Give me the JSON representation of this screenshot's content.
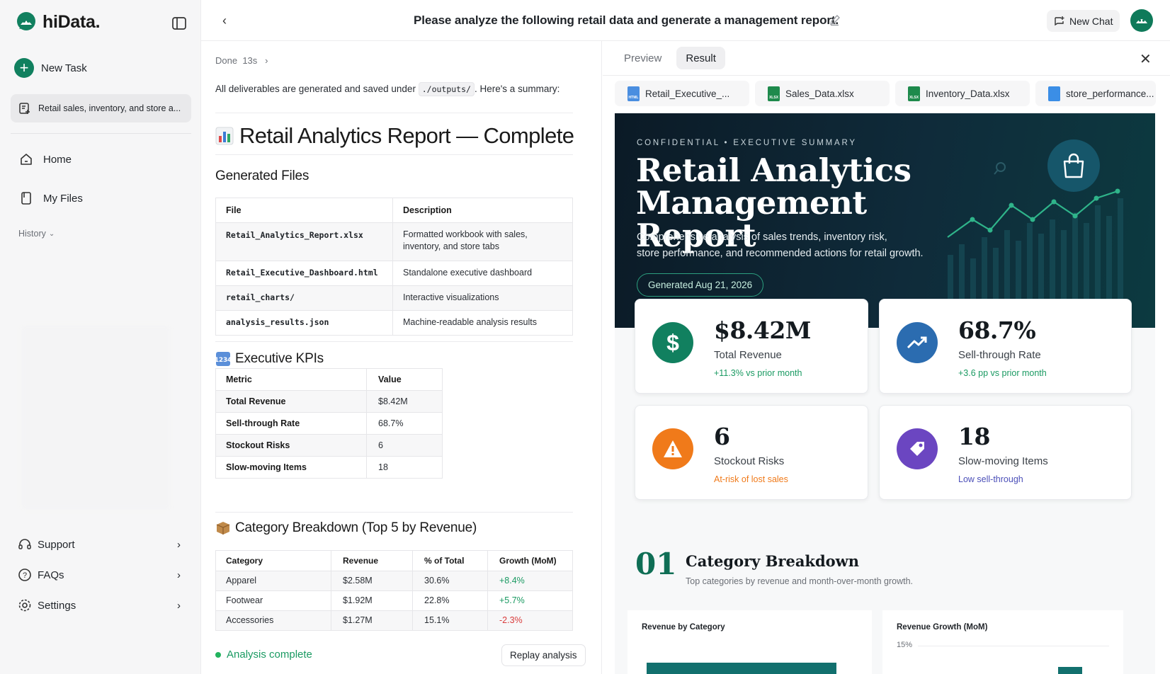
{
  "brand": {
    "name": "hiData."
  },
  "sidebar": {
    "new_task": "New Task",
    "active_task": "Retail sales, inventory, and store a...",
    "nav": [
      {
        "label": "Home"
      },
      {
        "label": "My Files"
      }
    ],
    "history": "History",
    "bottom": [
      {
        "label": "Support"
      },
      {
        "label": "FAQs"
      },
      {
        "label": "Settings"
      }
    ]
  },
  "topbar": {
    "title": "Please analyze the following retail data and generate a management report.",
    "new_chat": "New Chat"
  },
  "chat": {
    "done": "Done",
    "done_time": "13s",
    "summary_pre": "All deliverables are generated and saved under",
    "summary_code": "./outputs/",
    "summary_post": ". Here's a summary:",
    "report_title": "Retail Analytics Report — Complete",
    "files_heading": "Generated Files",
    "files_table": {
      "headers": [
        "File",
        "Description"
      ],
      "rows": [
        [
          "Retail_Analytics_Report.xlsx",
          "Formatted workbook with sales, inventory, and store tabs"
        ],
        [
          "Retail_Executive_Dashboard.html",
          "Standalone executive dashboard"
        ],
        [
          "retail_charts/",
          "Interactive visualizations"
        ],
        [
          "analysis_results.json",
          "Machine-readable analysis results"
        ]
      ]
    },
    "kpi_heading": "Executive KPIs",
    "kpi_table": {
      "headers": [
        "Metric",
        "Value"
      ],
      "rows": [
        [
          "Total Revenue",
          "$8.42M"
        ],
        [
          "Sell-through Rate",
          "68.7%"
        ],
        [
          "Stockout Risks",
          "6"
        ],
        [
          "Slow-moving Items",
          "18"
        ]
      ]
    },
    "category_heading": "Category Breakdown (Top 5 by Revenue)",
    "category_table": {
      "headers": [
        "Category",
        "Revenue",
        "% of Total",
        "Growth (MoM)"
      ],
      "rows": [
        [
          "Apparel",
          "$2.58M",
          "30.6%",
          "+8.4%"
        ],
        [
          "Footwear",
          "$1.92M",
          "22.8%",
          "+5.7%"
        ],
        [
          "Accessories",
          "$1.27M",
          "15.1%",
          "-2.3%"
        ]
      ]
    },
    "status": "Analysis complete",
    "replay": "Replay analysis"
  },
  "panel": {
    "tabs": [
      {
        "label": "Preview"
      },
      {
        "label": "Result"
      }
    ],
    "files": [
      {
        "name": "Retail_Executive_...",
        "type": "HTML",
        "color": "#4a8ee0"
      },
      {
        "name": "Sales_Data.xlsx",
        "type": "XLSX",
        "color": "#1e8a4c"
      },
      {
        "name": "Inventory_Data.xlsx",
        "type": "XLSX",
        "color": "#1e8a4c"
      },
      {
        "name": "store_performance...",
        "type": "",
        "color": "#3b8ee6"
      }
    ]
  },
  "report": {
    "eyebrow": "CONFIDENTIAL • EXECUTIVE SUMMARY",
    "title_line1": "Retail Analytics",
    "title_line2": "Management Report",
    "desc_line1": "Comprehensive analysis of sales trends, inventory risk,",
    "desc_line2": "store performance, and recommended actions for retail growth.",
    "generated": "Generated Aug 21, 2026",
    "kpis": [
      {
        "value": "$8.42M",
        "label": "Total Revenue",
        "sub": "+11.3% vs prior month",
        "color": "#11805f",
        "sub_color": "#1a9a62",
        "icon": "dollar-icon"
      },
      {
        "value": "68.7%",
        "label": "Sell-through Rate",
        "sub": "+3.6 pp vs prior month",
        "color": "#2b6cb0",
        "sub_color": "#1a9a62",
        "icon": "trend-up-icon"
      },
      {
        "value": "6",
        "label": "Stockout Risks",
        "sub": "At-risk of lost sales",
        "color": "#f07a1a",
        "sub_color": "#f07a1a",
        "icon": "warning-icon"
      },
      {
        "value": "18",
        "label": "Slow-moving Items",
        "sub": "Low sell-through",
        "color": "#6b46c1",
        "sub_color": "#4b4fb8",
        "icon": "tag-icon"
      }
    ],
    "section_num": "01",
    "section_title": "Category Breakdown",
    "section_sub": "Top categories by revenue and month-over-month growth.",
    "chart1_title": "Revenue by Category",
    "chart2_title": "Revenue Growth (MoM)",
    "chart2_tick": "15%"
  }
}
